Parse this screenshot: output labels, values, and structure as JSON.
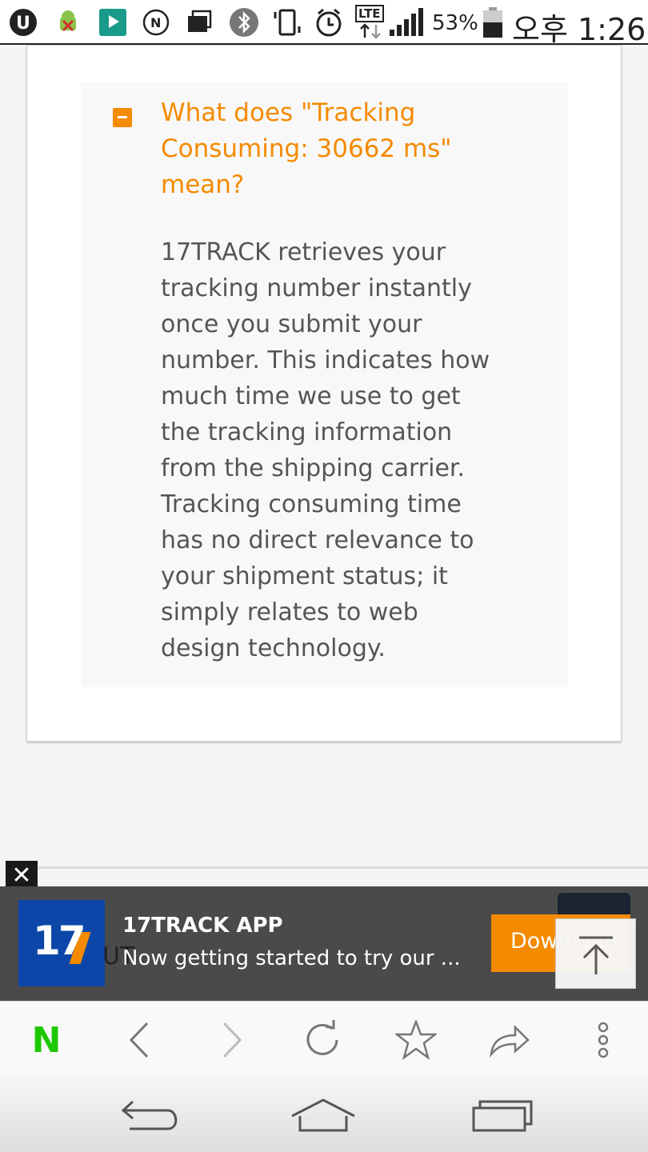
{
  "status_bar": {
    "battery": "53%",
    "time": "오후 1:26",
    "network": "LTE"
  },
  "faq": {
    "question": "What does \"Tracking Consuming: 30662 ms\" mean?",
    "answer": "17TRACK retrieves your tracking number instantly once you submit your number. This indicates how much time we use to get the tracking information from the shipping carrier. Tracking consuming time has no direct relevance to your shipment status; it simply relates to web design technology."
  },
  "ad_banner": {
    "close_glyph": "✕",
    "logo_text": "17",
    "behind_text": "UT",
    "title": "17TRACK APP",
    "subtitle": "Now getting started to try our ...",
    "button_label": "Download"
  },
  "browser_toolbar": {
    "naver_logo": "N",
    "icons": [
      "back-icon",
      "forward-icon",
      "refresh-icon",
      "star-icon",
      "share-icon",
      "more-icon"
    ]
  },
  "colors": {
    "accent": "#f48a00",
    "logo_blue": "#0c46a8",
    "naver_green": "#1ec800",
    "banner_bg": "#4a4a4a"
  }
}
